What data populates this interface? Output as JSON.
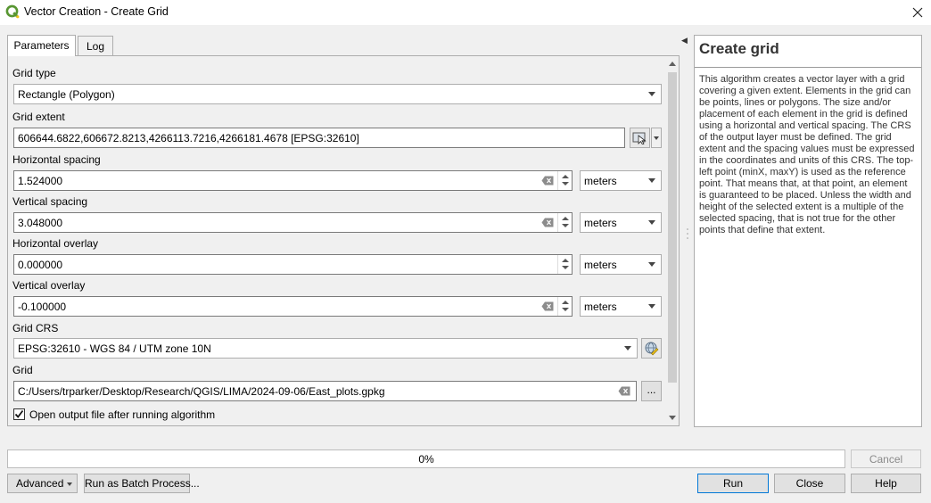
{
  "window": {
    "title": "Vector Creation - Create Grid"
  },
  "tabs": [
    {
      "label": "Parameters",
      "active": true
    },
    {
      "label": "Log",
      "active": false
    }
  ],
  "form": {
    "grid_type": {
      "label": "Grid type",
      "value": "Rectangle (Polygon)"
    },
    "grid_extent": {
      "label": "Grid extent",
      "value": "606644.6822,606672.8213,4266113.7216,4266181.4678 [EPSG:32610]"
    },
    "horizontal_spacing": {
      "label": "Horizontal spacing",
      "value": "1.524000",
      "unit": "meters"
    },
    "vertical_spacing": {
      "label": "Vertical spacing",
      "value": "3.048000",
      "unit": "meters"
    },
    "horizontal_overlay": {
      "label": "Horizontal overlay",
      "value": "0.000000",
      "unit": "meters"
    },
    "vertical_overlay": {
      "label": "Vertical overlay",
      "value": "-0.100000",
      "unit": "meters"
    },
    "grid_crs": {
      "label": "Grid CRS",
      "value": "EPSG:32610 - WGS 84 / UTM zone 10N"
    },
    "grid_output": {
      "label": "Grid",
      "value": "C:/Users/trparker/Desktop/Research/QGIS/LIMA/2024-09-06/East_plots.gpkg",
      "browse_label": "..."
    },
    "open_output": {
      "label": "Open output file after running algorithm",
      "checked": true
    }
  },
  "help": {
    "title": "Create grid",
    "text": "This algorithm creates a vector layer with a grid covering a given extent. Elements in the grid can be points, lines or polygons. The size and/or placement of each element in the grid is defined using a horizontal and vertical spacing. The CRS of the output layer must be defined. The grid extent and the spacing values must be expressed in the coordinates and units of this CRS. The top-left point (minX, maxY) is used as the reference point. That means that, at that point, an element is guaranteed to be placed. Unless the width and height of the selected extent is a multiple of the selected spacing, that is not true for the other points that define that extent."
  },
  "progress": {
    "text": "0%",
    "value": 0
  },
  "buttons": {
    "cancel": "Cancel",
    "advanced": "Advanced",
    "batch": "Run as Batch Process...",
    "run": "Run",
    "close": "Close",
    "help": "Help"
  },
  "icons": {
    "app": "qgis-logo-icon",
    "close": "close-icon",
    "extent": "select-extent-icon",
    "crs": "crs-select-icon",
    "clear": "clear-field-icon"
  },
  "colors": {
    "accent": "#0078d7",
    "qgis_green": "#589632",
    "qgis_yellow": "#f0c419"
  }
}
